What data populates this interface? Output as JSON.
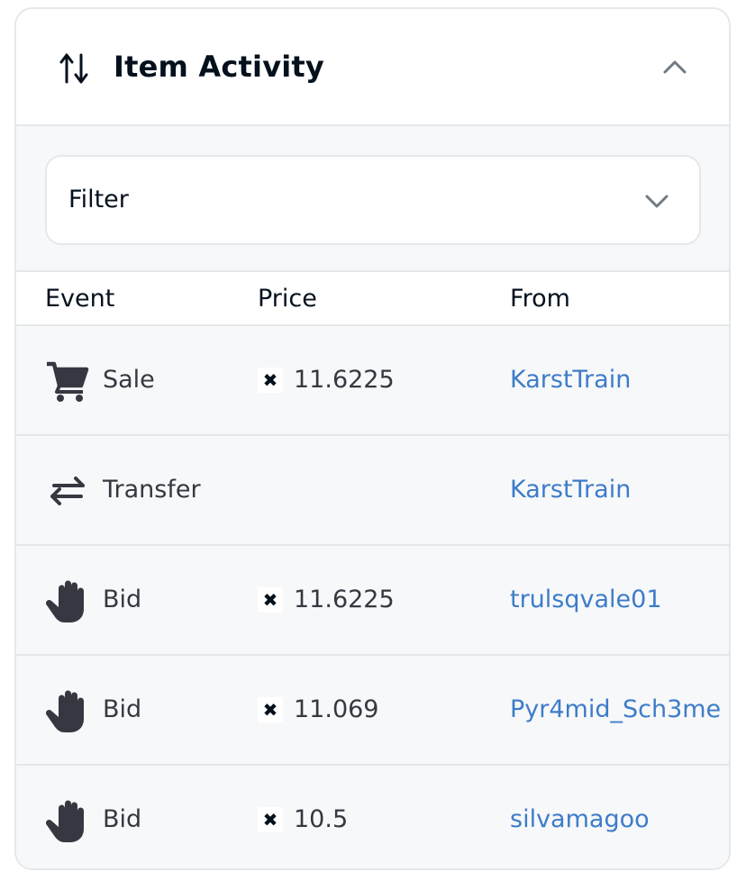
{
  "panel": {
    "title": "Item Activity",
    "title_icon": "sort-arrows-icon",
    "collapse_icon": "chevron-up-icon"
  },
  "filter": {
    "label": "Filter",
    "icon": "chevron-down-icon"
  },
  "table": {
    "headers": {
      "event": "Event",
      "price": "Price",
      "from": "From"
    },
    "rows": [
      {
        "event": "Sale",
        "icon": "cart-icon",
        "currency_icon": "eth-icon",
        "price": "11.6225",
        "from": "KarstTrain"
      },
      {
        "event": "Transfer",
        "icon": "transfer-icon",
        "currency_icon": "",
        "price": "",
        "from": "KarstTrain"
      },
      {
        "event": "Bid",
        "icon": "hand-icon",
        "currency_icon": "eth-icon",
        "price": "11.6225",
        "from": "trulsqvale01"
      },
      {
        "event": "Bid",
        "icon": "hand-icon",
        "currency_icon": "eth-icon",
        "price": "11.069",
        "from": "Pyr4mid_Sch3me"
      },
      {
        "event": "Bid",
        "icon": "hand-icon",
        "currency_icon": "eth-icon",
        "price": "10.5",
        "from": "silvamagoo"
      }
    ]
  },
  "colors": {
    "link": "#3d7cc9",
    "text_primary": "#04111d",
    "text_secondary": "#353840",
    "border": "#e5e8eb",
    "row_bg": "#f7f8fa"
  }
}
